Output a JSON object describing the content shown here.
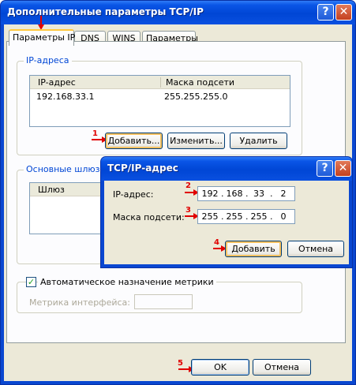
{
  "main": {
    "title": "Дополнительные параметры TCP/IP",
    "help_glyph": "?",
    "close_glyph": "✕",
    "tabs": [
      "Параметры IP",
      "DNS",
      "WINS",
      "Параметры"
    ],
    "ip_group": {
      "label": "IP-адреса",
      "columns": [
        "IP-адрес",
        "Маска подсети"
      ],
      "rows": [
        {
          "ip": "192.168.33.1",
          "mask": "255.255.255.0"
        }
      ],
      "buttons": {
        "add": "Добавить...",
        "edit": "Изменить...",
        "remove": "Удалить"
      }
    },
    "gateway_group": {
      "label": "Основные шлюзы:",
      "columns": [
        "Шлюз"
      ]
    },
    "metric": {
      "checkbox_label": "Автоматическое назначение метрики",
      "checked": true,
      "check_glyph": "✓",
      "interface_label": "Метрика интерфейса:"
    },
    "ok": "OK",
    "cancel": "Отмена"
  },
  "dialog": {
    "title": "TCP/IP-адрес",
    "help_glyph": "?",
    "close_glyph": "✕",
    "ip_label": "IP-адрес:",
    "ip_octets": [
      "192",
      "168",
      "33",
      "2"
    ],
    "mask_label": "Маска подсети:",
    "mask_octets": [
      "255",
      "255",
      "255",
      "0"
    ],
    "dot": ".",
    "add": "Добавить",
    "cancel": "Отмена"
  },
  "markers": [
    "1",
    "2",
    "3",
    "4",
    "5"
  ]
}
